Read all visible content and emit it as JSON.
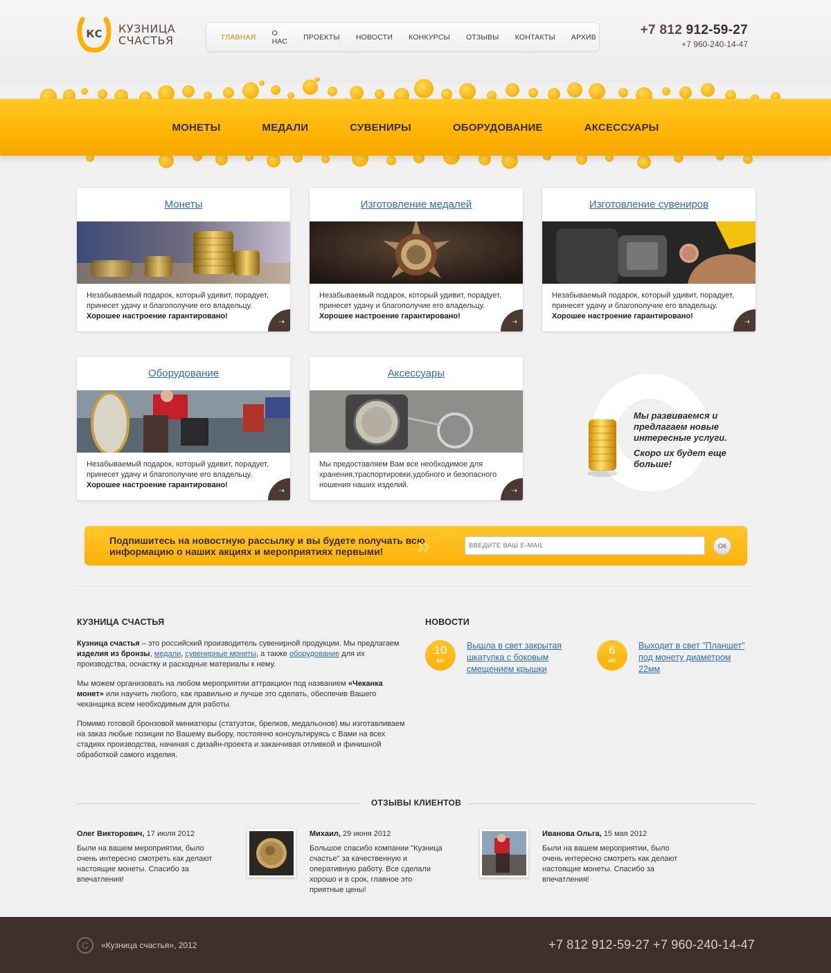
{
  "brand": {
    "line1": "КУЗНИЦА",
    "line2": "СЧАСТЬЯ",
    "mark": "КС"
  },
  "topnav": [
    "ГЛАВНАЯ",
    "О НАС",
    "ПРОЕКТЫ",
    "НОВОСТИ",
    "КОНКУРСЫ",
    "ОТЗЫВЫ",
    "КОНТАКТЫ",
    "АРХИВ"
  ],
  "phones": {
    "prefix": "+7 812 ",
    "main": "912-59-27",
    "alt": "+7 960-240-14-47"
  },
  "catnav": [
    "МОНЕТЫ",
    "МЕДАЛИ",
    "СУВЕНИРЫ",
    "ОБОРУДОВАНИЕ",
    "АКСЕССУАРЫ"
  ],
  "cards": [
    {
      "title": "Монеты",
      "text": "Незабываемый подарок, который удивит, порадует, принесет удачу и благополучие его владельцу.",
      "bold": "Хорошее настроение гарантировано!"
    },
    {
      "title": "Изготовление медалей",
      "text": "Незабываемый подарок, который удивит, порадует, принесет удачу и благополучие его владельцу.",
      "bold": "Хорошее настроение гарантировано!"
    },
    {
      "title": "Изготовление сувениров",
      "text": "Незабываемый подарок, который удивит, порадует, принесет удачу и благополучие его владельцу.",
      "bold": "Хорошее настроение гарантировано!"
    },
    {
      "title": "Оборудование",
      "text": "Незабываемый подарок, который удивит, порадует, принесет удачу и благополучие его владельцу.",
      "bold": "Хорошее настроение гарантировано!"
    },
    {
      "title": "Аксессуары",
      "text": "Мы предоставляем Вам все необходимое для хранения,траспортировки,удобного и безопасного ношения наших изделий.",
      "bold": ""
    }
  ],
  "promo": {
    "p1": "Мы развиваемся и предлагаем новые интересные услуги.",
    "p2": "Скоро их будет еще больше!"
  },
  "subscribe": {
    "text": "Подпишитесь на новостную рассылку и вы будете получать всю информацию о наших акциях и мероприятиях первыми!",
    "placeholder": "ВВЕДИТЕ ВАШ E-MAIL",
    "button": "ОК"
  },
  "about": {
    "heading": "КУЗНИЦА СЧАСТЬЯ",
    "p1_b1": "Кузница счастья",
    "p1_t1": " – это российский производитель сувенирной продукции. Мы предлагаем ",
    "p1_b2": "изделия из бронзы",
    "p1_t2": ", ",
    "p1_l1": "медали",
    "p1_t3": ", ",
    "p1_l2": "сувенирные монеты",
    "p1_t4": ",  а также ",
    "p1_l3": "оборудование",
    "p1_t5": " для их производства,  оснастку и расходные материалы к нему.",
    "p2_t1": "Мы можем организовать на любом мероприятии аттракцион под названием ",
    "p2_b1": "«Чеканка монет»",
    "p2_t2": " или научить любого, как правильно и лучше это сделать, обеспечив Вашего чеканщика всем необходимым для работы.",
    "p3": "Помимо готовой бронзовой миниатюры (статуэток, брелков, медальонов) мы изготавливаем  на заказ любые позиции по Вашему выбору, постоянно консультируясь с Вами на всех стадиях  производства, начиная с дизайн-проекта и заканчивая отливкой и финишной обработкой самого изделия."
  },
  "news": {
    "heading": "НОВОСТИ",
    "items": [
      {
        "day": "10",
        "month": "авг",
        "text": "Вышла в свет закрытая шкатулка с боковым смещением крышки"
      },
      {
        "day": "6",
        "month": "авг",
        "text": "Выходит в свет \"Планшет\" под монету диаметром 22мм"
      }
    ]
  },
  "reviews": {
    "heading": "ОТЗЫВЫ КЛИЕНТОВ",
    "items": [
      {
        "name": "Олег Викторович,",
        "date": " 17 июля 2012",
        "text": "Были на вашем мероприятии, было очень интересно смотреть как делают настоящие монеты. Спасибо за впечатления!"
      },
      {
        "name": "Михаил,",
        "date": " 29 июня 2012",
        "text": "Большое спасибо компании \"Кузница счастье\" за качественную и оперативную работу. Все сделали хорошо и в срок, главное это приятные цены!"
      },
      {
        "name": "Иванова Ольга,",
        "date": " 15 мая 2012",
        "text": "Были на вашем мероприятии, было очень интересно смотреть как делают настоящие монеты. Спасибо за впечатления!"
      }
    ]
  },
  "footer": {
    "copyright_symbol": "C",
    "copy": "«Кузница счастья», 2012",
    "phones": "+7 812 912-59-27 +7 960-240-14-47"
  },
  "icons": {
    "arrow": "arrow-right-icon",
    "logo": "horseshoe-logo-icon",
    "copyright": "copyright-icon"
  },
  "colors": {
    "accent": "#fdb404",
    "brown": "#3f2e29",
    "link": "#2f6db5",
    "nav_active": "#cf8c00"
  }
}
